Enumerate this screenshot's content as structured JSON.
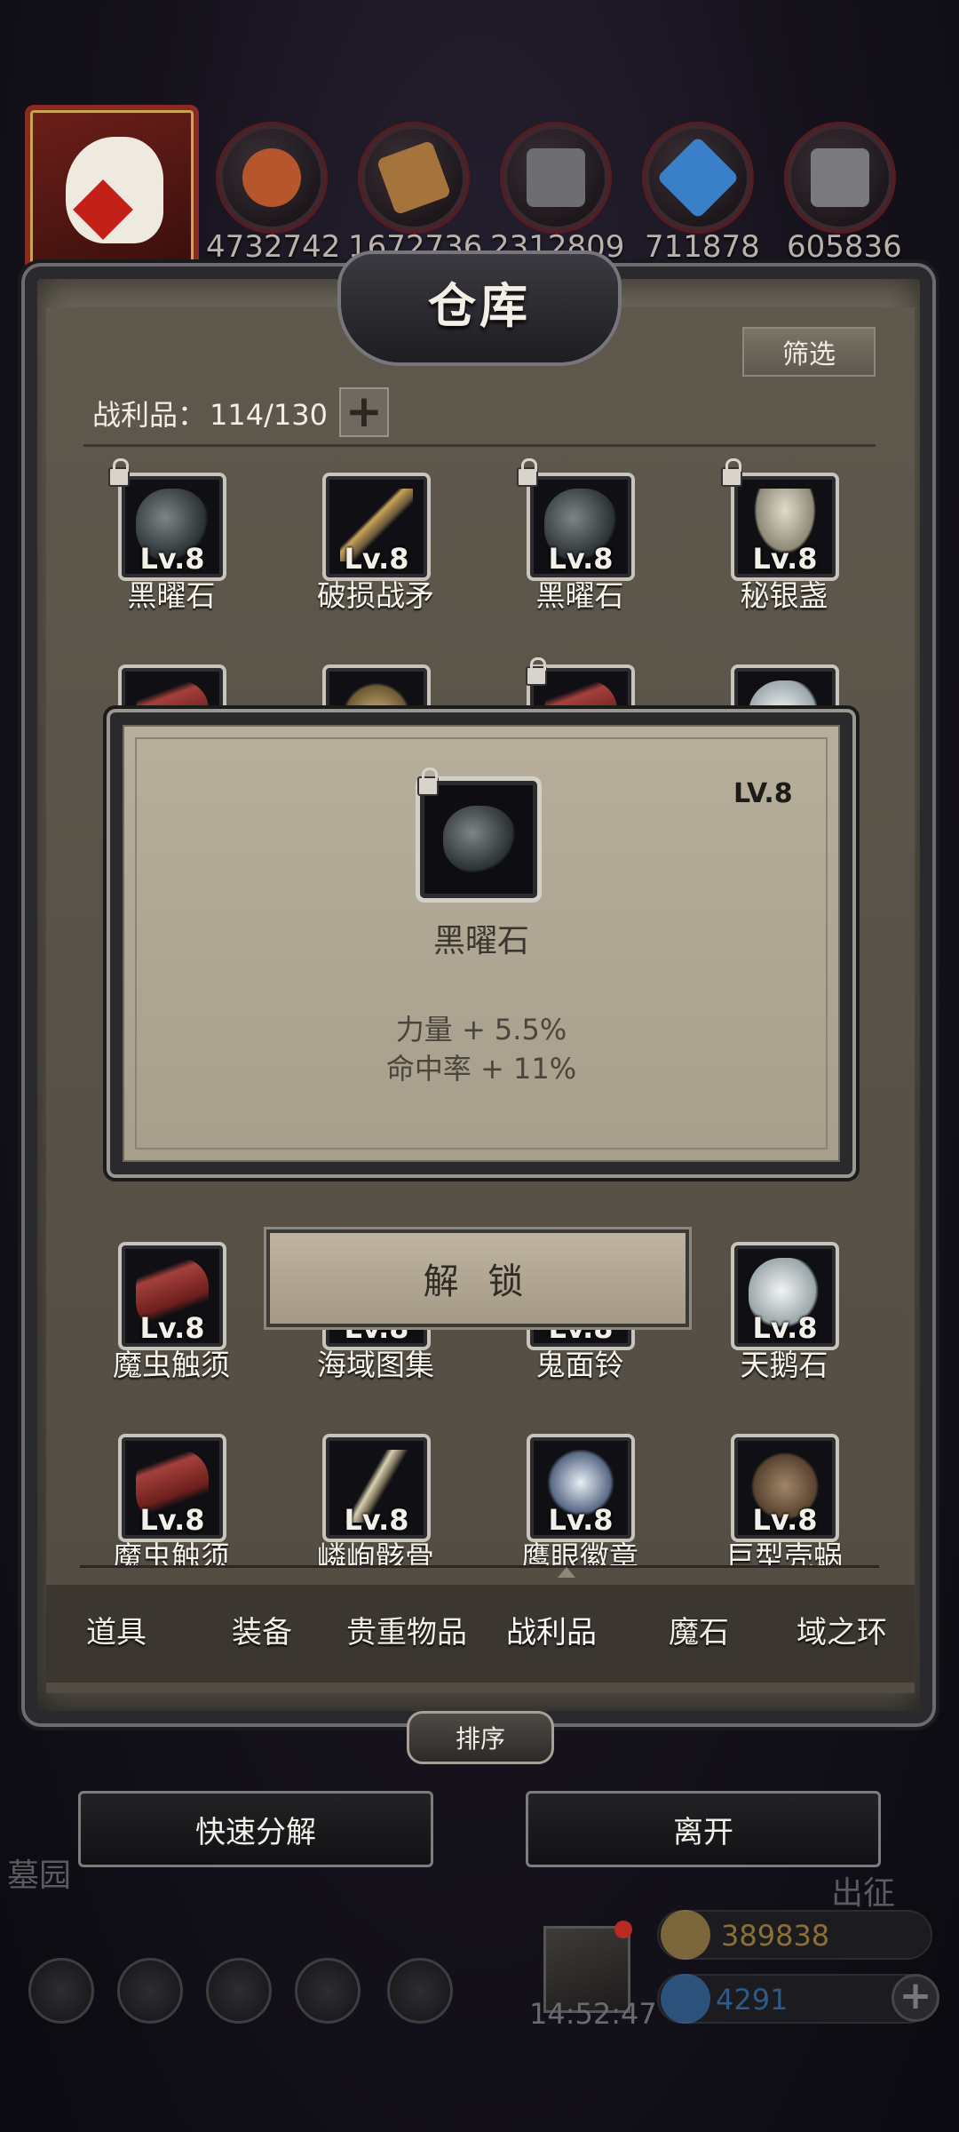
{
  "resources": [
    {
      "name": "meat",
      "value": "4732742",
      "color": "#b5562c"
    },
    {
      "name": "wood",
      "value": "1672736",
      "color": "#a5733c"
    },
    {
      "name": "stone",
      "value": "2312809",
      "color": "#6e6e70"
    },
    {
      "name": "crystal",
      "value": "711878",
      "color": "#3a80c8"
    },
    {
      "name": "iron",
      "value": "605836",
      "color": "#7a7a7e"
    }
  ],
  "warehouse": {
    "title": "仓库",
    "filter_label": "筛选",
    "loot_label": "战利品：",
    "loot_count": "114/130",
    "add_icon": "plus-icon"
  },
  "items_row1": [
    {
      "level": "Lv.8",
      "name": "黑曜石",
      "locked": true,
      "art": "obsidian"
    },
    {
      "level": "Lv.8",
      "name": "破损战矛",
      "locked": false,
      "art": "spear"
    },
    {
      "level": "Lv.8",
      "name": "黑曜石",
      "locked": true,
      "art": "obsidian"
    },
    {
      "level": "Lv.8",
      "name": "秘银盏",
      "locked": true,
      "art": "cup"
    }
  ],
  "items_row5": [
    {
      "level": "Lv.8",
      "name": "魔虫触须",
      "locked": false,
      "art": "tentacle"
    },
    {
      "level": "Lv.8",
      "name": "海域图集",
      "locked": false,
      "art": "map"
    },
    {
      "level": "Lv.8",
      "name": "鬼面铃",
      "locked": false,
      "art": "badge"
    },
    {
      "level": "Lv.8",
      "name": "天鹅石",
      "locked": false,
      "art": "swan"
    }
  ],
  "items_row6": [
    {
      "level": "Lv.8",
      "name": "魔虫触须",
      "locked": false,
      "art": "tentacle"
    },
    {
      "level": "Lv.8",
      "name": "嶙峋骸骨",
      "locked": false,
      "art": "bone"
    },
    {
      "level": "Lv.8",
      "name": "鹰眼徽章",
      "locked": false,
      "art": "badge"
    },
    {
      "level": "Lv.8",
      "name": "巨型壳蜗",
      "locked": false,
      "art": "shell"
    }
  ],
  "popup": {
    "level": "LV.8",
    "name": "黑曜石",
    "stats": [
      "力量 + 5.5%",
      "命中率 + 11%"
    ],
    "unlock_label": "解 锁"
  },
  "tabs": [
    "道具",
    "装备",
    "贵重物品",
    "战利品",
    "魔石",
    "域之环"
  ],
  "active_tab": "战利品",
  "sort_label": "排序",
  "quick_decompose_label": "快速分解",
  "leave_label": "离开",
  "hud": {
    "left_label": "墓园",
    "right_label": "出征",
    "timer": "14:52:47",
    "gold": "389838",
    "gems": "4291",
    "gold_color": "#c9a451",
    "gem_color": "#3a80c8"
  }
}
